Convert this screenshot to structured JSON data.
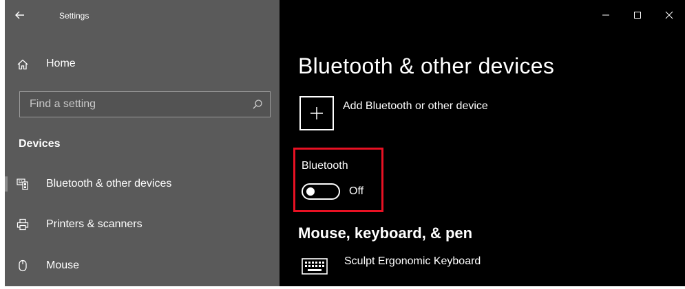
{
  "window": {
    "title": "Settings",
    "controls": [
      "minimize",
      "maximize",
      "close"
    ]
  },
  "sidebar": {
    "home_label": "Home",
    "search": {
      "placeholder": "Find a setting",
      "value": ""
    },
    "section_title": "Devices",
    "items": [
      {
        "label": "Bluetooth & other devices",
        "icon": "bluetooth-devices-icon",
        "selected": true
      },
      {
        "label": "Printers & scanners",
        "icon": "printer-icon",
        "selected": false
      },
      {
        "label": "Mouse",
        "icon": "mouse-icon",
        "selected": false
      }
    ]
  },
  "main": {
    "title": "Bluetooth & other devices",
    "add_device_label": "Add Bluetooth or other device",
    "bluetooth": {
      "label": "Bluetooth",
      "state": "Off",
      "highlight_color": "#e81123"
    },
    "section_mouse_title": "Mouse, keyboard, & pen",
    "devices": [
      {
        "name": "Sculpt Ergonomic Keyboard",
        "icon": "keyboard-icon"
      }
    ]
  },
  "colors": {
    "sidebar_bg": "#5a5a5a",
    "main_bg": "#000000",
    "highlight": "#e81123"
  }
}
